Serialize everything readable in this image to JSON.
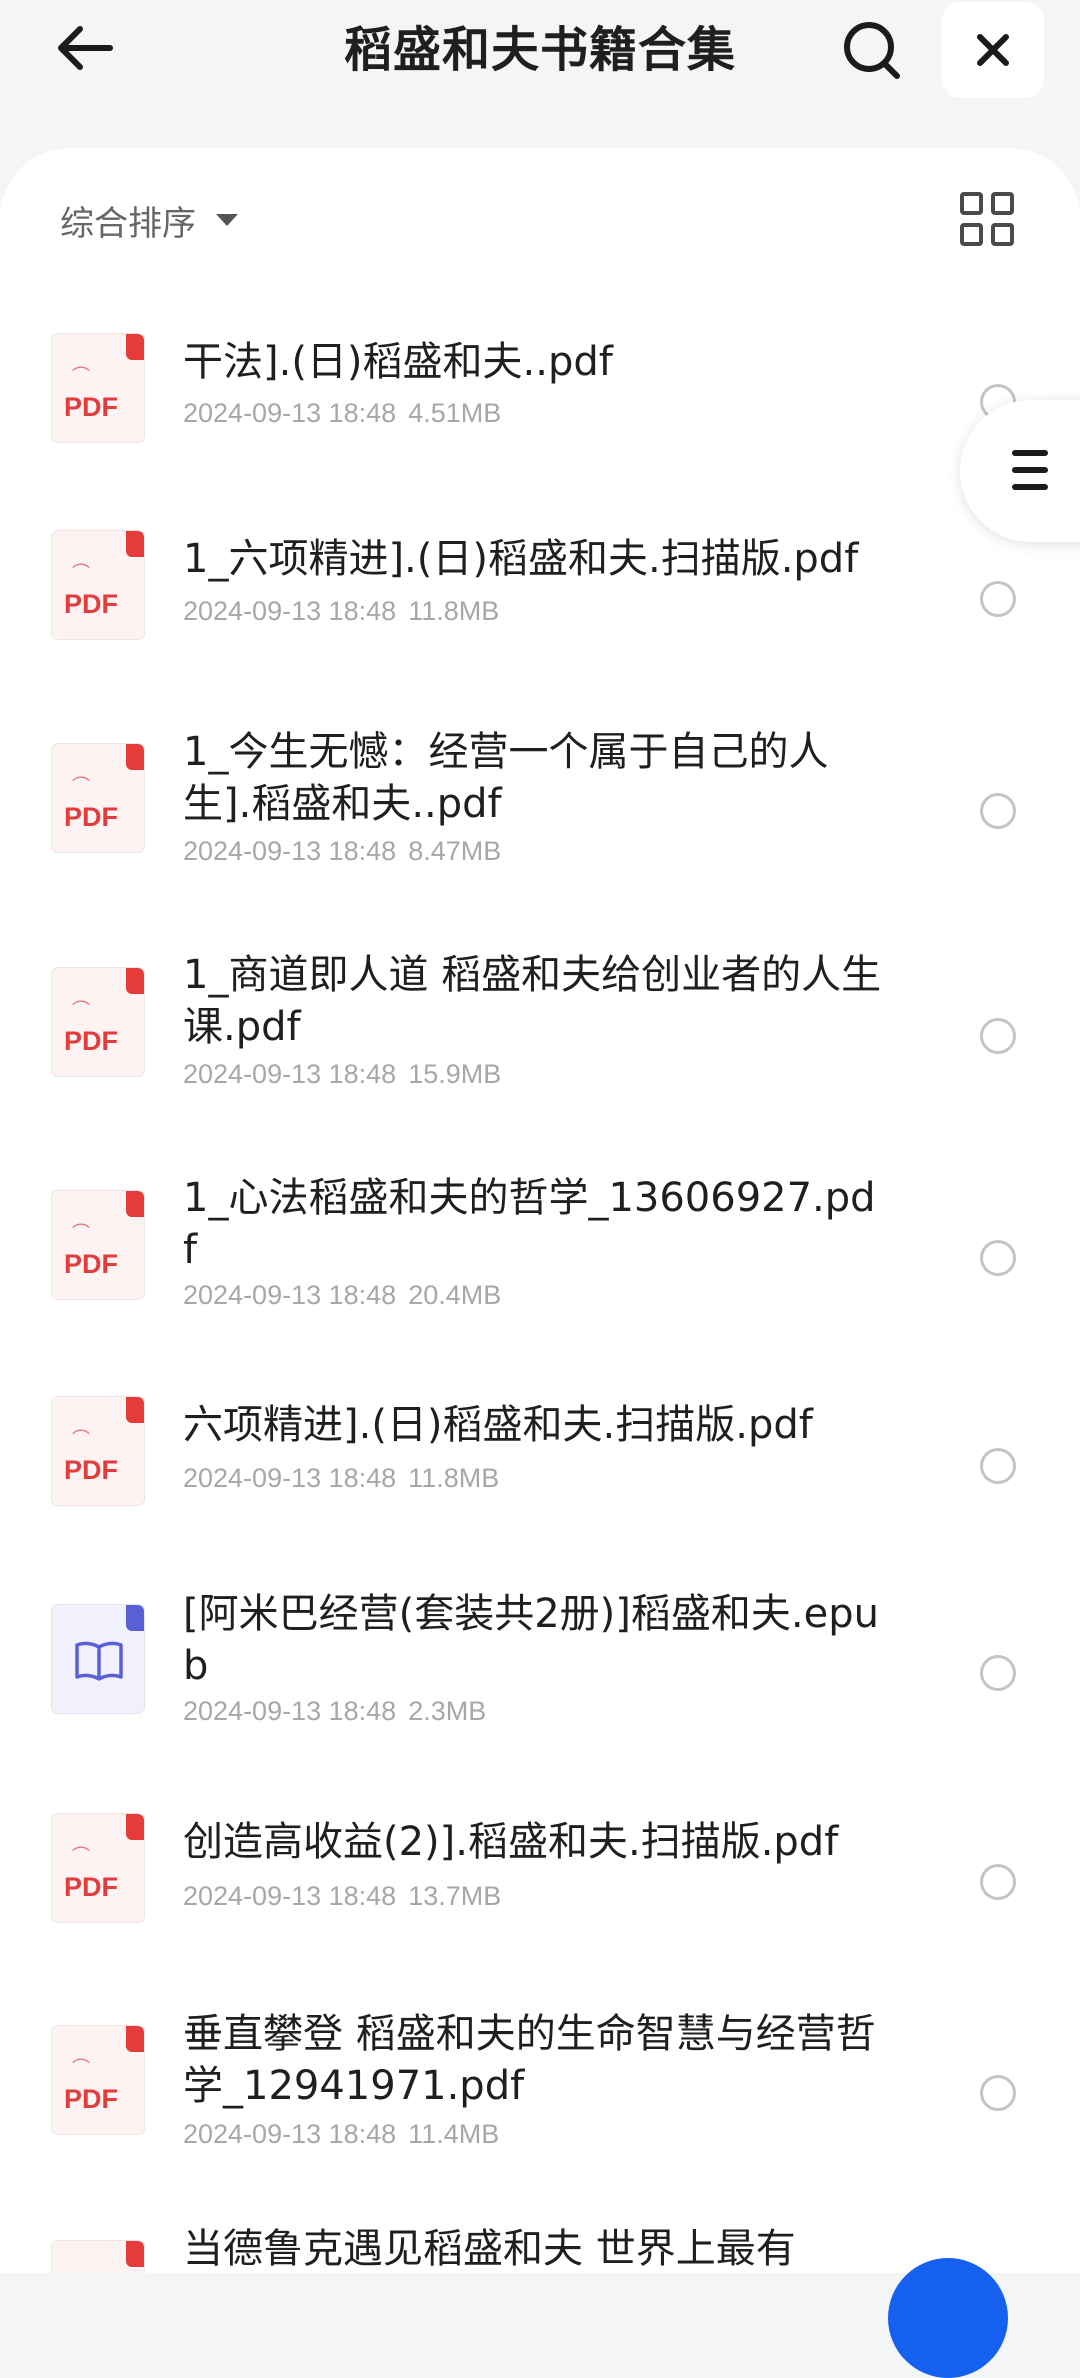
{
  "header": {
    "title": "稻盛和夫书籍合集"
  },
  "toolbar": {
    "sort_label": "综合排序"
  },
  "files": [
    {
      "name": "干法].(日)稻盛和夫..pdf",
      "date": "2024-09-13 18:48",
      "size": "4.51MB",
      "type": "pdf",
      "badge": "PDF"
    },
    {
      "name": "1_六项精进].(日)稻盛和夫.扫描版.pdf",
      "date": "2024-09-13 18:48",
      "size": "11.8MB",
      "type": "pdf",
      "badge": "PDF"
    },
    {
      "name": "1_今生无憾：经营一个属于自己的人生].稻盛和夫..pdf",
      "date": "2024-09-13 18:48",
      "size": "8.47MB",
      "type": "pdf",
      "badge": "PDF"
    },
    {
      "name": "1_商道即人道 稻盛和夫给创业者的人生课.pdf",
      "date": "2024-09-13 18:48",
      "size": "15.9MB",
      "type": "pdf",
      "badge": "PDF"
    },
    {
      "name": "1_心法稻盛和夫的哲学_13606927.pdf",
      "date": "2024-09-13 18:48",
      "size": "20.4MB",
      "type": "pdf",
      "badge": "PDF"
    },
    {
      "name": "六项精进].(日)稻盛和夫.扫描版.pdf",
      "date": "2024-09-13 18:48",
      "size": "11.8MB",
      "type": "pdf",
      "badge": "PDF"
    },
    {
      "name": "[阿米巴经营(套装共2册)]稻盛和夫.epub",
      "date": "2024-09-13 18:48",
      "size": "2.3MB",
      "type": "epub",
      "badge": ""
    },
    {
      "name": "创造高收益(2)].稻盛和夫.扫描版.pdf",
      "date": "2024-09-13 18:48",
      "size": "13.7MB",
      "type": "pdf",
      "badge": "PDF"
    },
    {
      "name": "垂直攀登 稻盛和夫的生命智慧与经营哲学_12941971.pdf",
      "date": "2024-09-13 18:48",
      "size": "11.4MB",
      "type": "pdf",
      "badge": "PDF"
    },
    {
      "name": "当德鲁克遇见稻盛和夫 世界上最有",
      "date": "",
      "size": "",
      "type": "pdf",
      "badge": "PDF"
    }
  ],
  "icons": {
    "back": "arrow-left-icon",
    "search": "search-icon",
    "close": "close-icon",
    "sort": "caret-down-icon",
    "view": "grid-view-icon",
    "menu": "menu-icon"
  },
  "colors": {
    "pdf_accent": "#e53b3b",
    "epub_accent": "#5a5fd8",
    "fab": "#1660f0"
  }
}
